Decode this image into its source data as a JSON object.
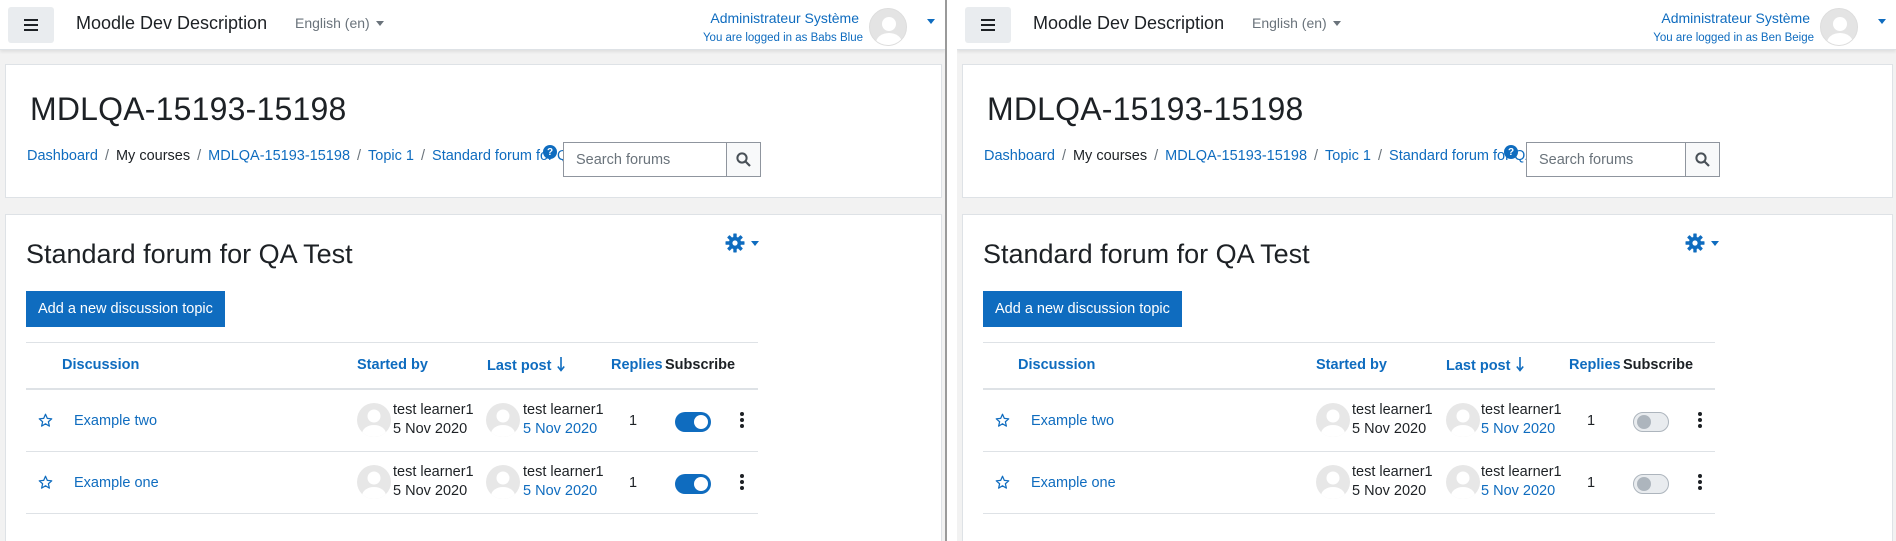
{
  "panes": [
    {
      "navbar": {
        "site_name": "Moodle Dev Description",
        "language": "English (en)",
        "user_name": "Administrateur Système",
        "logged_in_as": "You are logged in as Babs Blue"
      },
      "header": {
        "course_title": "MDLQA-15193-15198",
        "breadcrumb": [
          "Dashboard",
          "My courses",
          "MDLQA-15193-15198",
          "Topic 1",
          "Standard forum for QA Test"
        ],
        "search_placeholder": "Search forums"
      },
      "forum": {
        "title": "Standard forum for QA Test",
        "add_button": "Add a new discussion topic",
        "columns": [
          "Discussion",
          "Started by",
          "Last post",
          "Replies",
          "Subscribe"
        ],
        "rows": [
          {
            "discussion": "Example two",
            "started_by": "test learner1",
            "started_date": "5 Nov 2020",
            "last_post_by": "test learner1",
            "last_post_date": "5 Nov 2020",
            "replies": "1",
            "subscribed": true
          },
          {
            "discussion": "Example one",
            "started_by": "test learner1",
            "started_date": "5 Nov 2020",
            "last_post_by": "test learner1",
            "last_post_date": "5 Nov 2020",
            "replies": "1",
            "subscribed": true
          }
        ]
      }
    },
    {
      "navbar": {
        "site_name": "Moodle Dev Description",
        "language": "English (en)",
        "user_name": "Administrateur Système",
        "logged_in_as": "You are logged in as Ben Beige"
      },
      "header": {
        "course_title": "MDLQA-15193-15198",
        "breadcrumb": [
          "Dashboard",
          "My courses",
          "MDLQA-15193-15198",
          "Topic 1",
          "Standard forum for QA Test"
        ],
        "search_placeholder": "Search forums"
      },
      "forum": {
        "title": "Standard forum for QA Test",
        "add_button": "Add a new discussion topic",
        "columns": [
          "Discussion",
          "Started by",
          "Last post",
          "Replies",
          "Subscribe"
        ],
        "rows": [
          {
            "discussion": "Example two",
            "started_by": "test learner1",
            "started_date": "5 Nov 2020",
            "last_post_by": "test learner1",
            "last_post_date": "5 Nov 2020",
            "replies": "1",
            "subscribed": false
          },
          {
            "discussion": "Example one",
            "started_by": "test learner1",
            "started_date": "5 Nov 2020",
            "last_post_by": "test learner1",
            "last_post_date": "5 Nov 2020",
            "replies": "1",
            "subscribed": false
          }
        ]
      }
    }
  ],
  "colors": {
    "accent": "#0f6cbf",
    "text": "#1d2125",
    "muted": "#6a737b",
    "page_bg": "#f2f2f2",
    "border": "#dee2e6"
  }
}
